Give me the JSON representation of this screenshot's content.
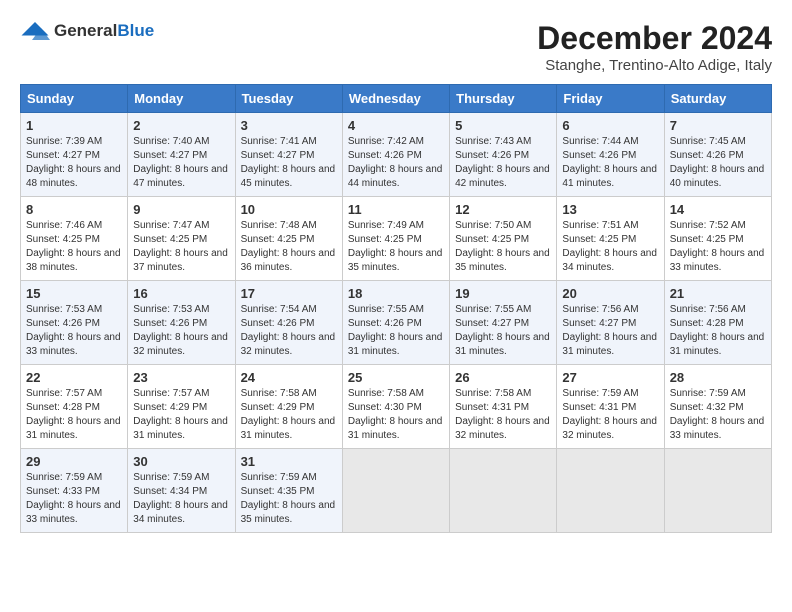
{
  "logo": {
    "general": "General",
    "blue": "Blue"
  },
  "title": "December 2024",
  "subtitle": "Stanghe, Trentino-Alto Adige, Italy",
  "days_header": [
    "Sunday",
    "Monday",
    "Tuesday",
    "Wednesday",
    "Thursday",
    "Friday",
    "Saturday"
  ],
  "weeks": [
    [
      {
        "day": "1",
        "sunrise": "7:39 AM",
        "sunset": "4:27 PM",
        "daylight": "8 hours and 48 minutes."
      },
      {
        "day": "2",
        "sunrise": "7:40 AM",
        "sunset": "4:27 PM",
        "daylight": "8 hours and 47 minutes."
      },
      {
        "day": "3",
        "sunrise": "7:41 AM",
        "sunset": "4:27 PM",
        "daylight": "8 hours and 45 minutes."
      },
      {
        "day": "4",
        "sunrise": "7:42 AM",
        "sunset": "4:26 PM",
        "daylight": "8 hours and 44 minutes."
      },
      {
        "day": "5",
        "sunrise": "7:43 AM",
        "sunset": "4:26 PM",
        "daylight": "8 hours and 42 minutes."
      },
      {
        "day": "6",
        "sunrise": "7:44 AM",
        "sunset": "4:26 PM",
        "daylight": "8 hours and 41 minutes."
      },
      {
        "day": "7",
        "sunrise": "7:45 AM",
        "sunset": "4:26 PM",
        "daylight": "8 hours and 40 minutes."
      }
    ],
    [
      {
        "day": "8",
        "sunrise": "7:46 AM",
        "sunset": "4:25 PM",
        "daylight": "8 hours and 38 minutes."
      },
      {
        "day": "9",
        "sunrise": "7:47 AM",
        "sunset": "4:25 PM",
        "daylight": "8 hours and 37 minutes."
      },
      {
        "day": "10",
        "sunrise": "7:48 AM",
        "sunset": "4:25 PM",
        "daylight": "8 hours and 36 minutes."
      },
      {
        "day": "11",
        "sunrise": "7:49 AM",
        "sunset": "4:25 PM",
        "daylight": "8 hours and 35 minutes."
      },
      {
        "day": "12",
        "sunrise": "7:50 AM",
        "sunset": "4:25 PM",
        "daylight": "8 hours and 35 minutes."
      },
      {
        "day": "13",
        "sunrise": "7:51 AM",
        "sunset": "4:25 PM",
        "daylight": "8 hours and 34 minutes."
      },
      {
        "day": "14",
        "sunrise": "7:52 AM",
        "sunset": "4:25 PM",
        "daylight": "8 hours and 33 minutes."
      }
    ],
    [
      {
        "day": "15",
        "sunrise": "7:53 AM",
        "sunset": "4:26 PM",
        "daylight": "8 hours and 33 minutes."
      },
      {
        "day": "16",
        "sunrise": "7:53 AM",
        "sunset": "4:26 PM",
        "daylight": "8 hours and 32 minutes."
      },
      {
        "day": "17",
        "sunrise": "7:54 AM",
        "sunset": "4:26 PM",
        "daylight": "8 hours and 32 minutes."
      },
      {
        "day": "18",
        "sunrise": "7:55 AM",
        "sunset": "4:26 PM",
        "daylight": "8 hours and 31 minutes."
      },
      {
        "day": "19",
        "sunrise": "7:55 AM",
        "sunset": "4:27 PM",
        "daylight": "8 hours and 31 minutes."
      },
      {
        "day": "20",
        "sunrise": "7:56 AM",
        "sunset": "4:27 PM",
        "daylight": "8 hours and 31 minutes."
      },
      {
        "day": "21",
        "sunrise": "7:56 AM",
        "sunset": "4:28 PM",
        "daylight": "8 hours and 31 minutes."
      }
    ],
    [
      {
        "day": "22",
        "sunrise": "7:57 AM",
        "sunset": "4:28 PM",
        "daylight": "8 hours and 31 minutes."
      },
      {
        "day": "23",
        "sunrise": "7:57 AM",
        "sunset": "4:29 PM",
        "daylight": "8 hours and 31 minutes."
      },
      {
        "day": "24",
        "sunrise": "7:58 AM",
        "sunset": "4:29 PM",
        "daylight": "8 hours and 31 minutes."
      },
      {
        "day": "25",
        "sunrise": "7:58 AM",
        "sunset": "4:30 PM",
        "daylight": "8 hours and 31 minutes."
      },
      {
        "day": "26",
        "sunrise": "7:58 AM",
        "sunset": "4:31 PM",
        "daylight": "8 hours and 32 minutes."
      },
      {
        "day": "27",
        "sunrise": "7:59 AM",
        "sunset": "4:31 PM",
        "daylight": "8 hours and 32 minutes."
      },
      {
        "day": "28",
        "sunrise": "7:59 AM",
        "sunset": "4:32 PM",
        "daylight": "8 hours and 33 minutes."
      }
    ],
    [
      {
        "day": "29",
        "sunrise": "7:59 AM",
        "sunset": "4:33 PM",
        "daylight": "8 hours and 33 minutes."
      },
      {
        "day": "30",
        "sunrise": "7:59 AM",
        "sunset": "4:34 PM",
        "daylight": "8 hours and 34 minutes."
      },
      {
        "day": "31",
        "sunrise": "7:59 AM",
        "sunset": "4:35 PM",
        "daylight": "8 hours and 35 minutes."
      },
      null,
      null,
      null,
      null
    ]
  ]
}
